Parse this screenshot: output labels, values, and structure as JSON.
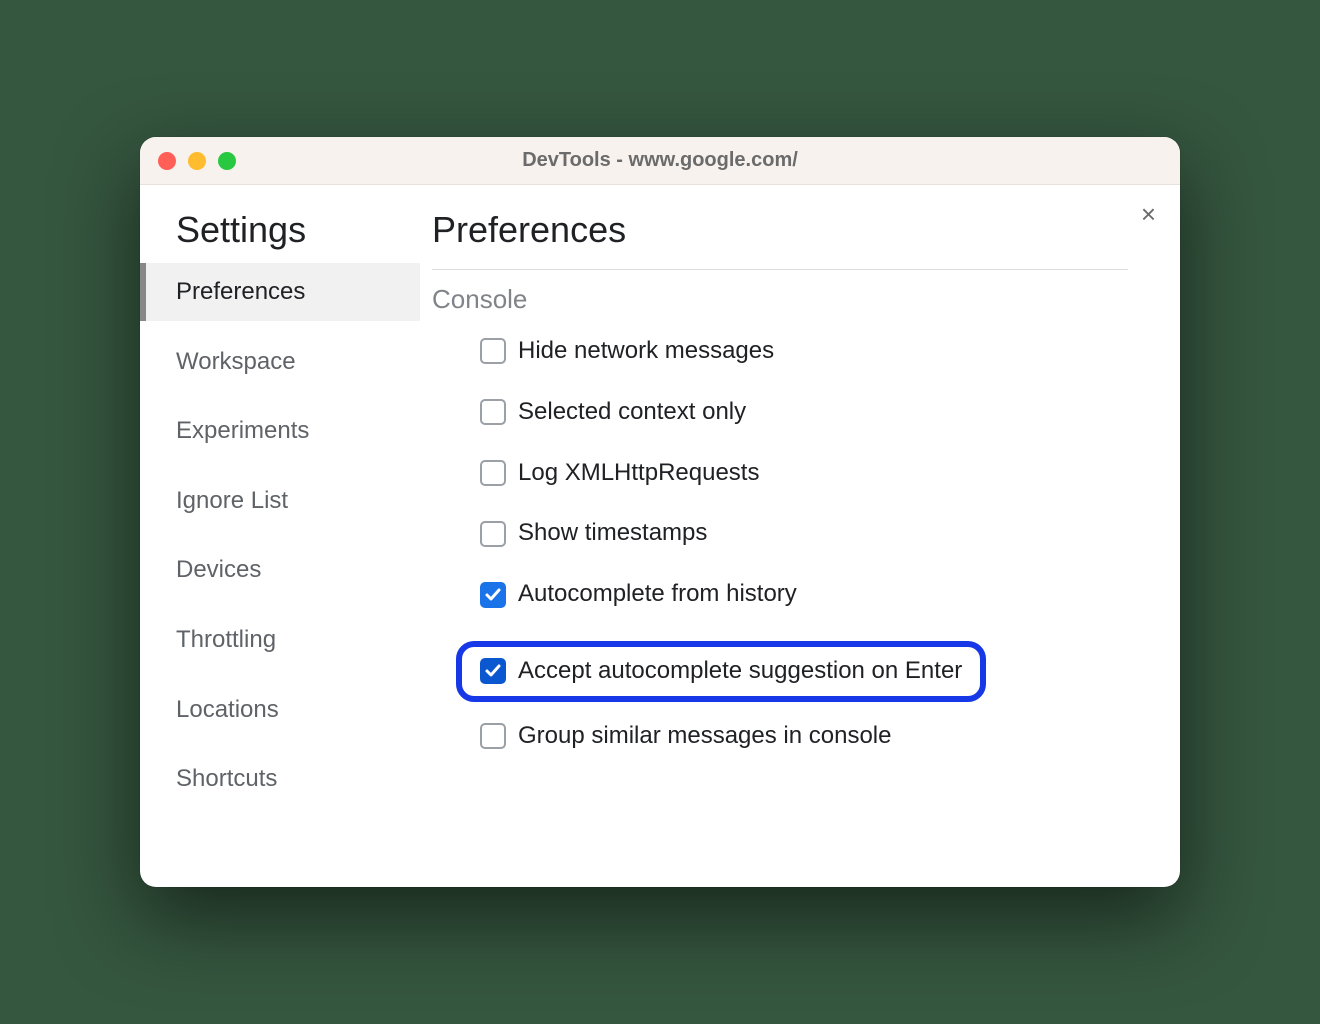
{
  "window": {
    "title": "DevTools - www.google.com/"
  },
  "sidebar": {
    "heading": "Settings",
    "items": [
      {
        "label": "Preferences",
        "active": true
      },
      {
        "label": "Workspace",
        "active": false
      },
      {
        "label": "Experiments",
        "active": false
      },
      {
        "label": "Ignore List",
        "active": false
      },
      {
        "label": "Devices",
        "active": false
      },
      {
        "label": "Throttling",
        "active": false
      },
      {
        "label": "Locations",
        "active": false
      },
      {
        "label": "Shortcuts",
        "active": false
      }
    ]
  },
  "main": {
    "heading": "Preferences",
    "section": "Console",
    "options": [
      {
        "label": "Hide network messages",
        "checked": false,
        "highlighted": false
      },
      {
        "label": "Selected context only",
        "checked": false,
        "highlighted": false
      },
      {
        "label": "Log XMLHttpRequests",
        "checked": false,
        "highlighted": false
      },
      {
        "label": "Show timestamps",
        "checked": false,
        "highlighted": false
      },
      {
        "label": "Autocomplete from history",
        "checked": true,
        "highlighted": false
      },
      {
        "label": "Accept autocomplete suggestion on Enter",
        "checked": true,
        "highlighted": true
      },
      {
        "label": "Group similar messages in console",
        "checked": false,
        "highlighted": false
      }
    ]
  }
}
